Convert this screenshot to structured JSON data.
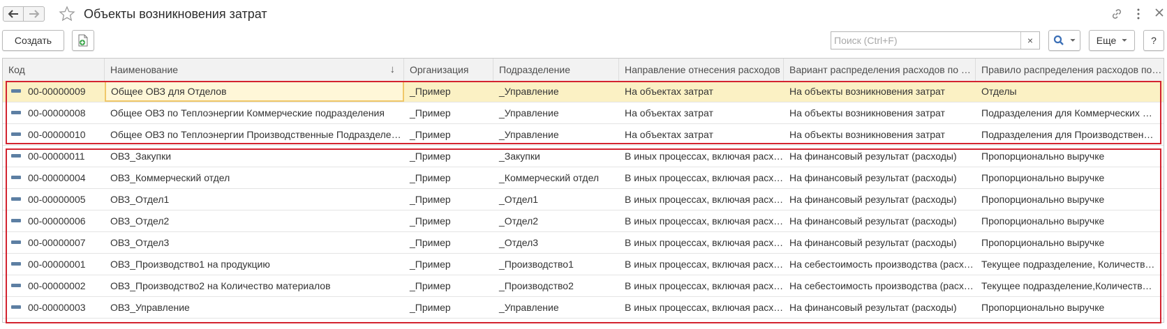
{
  "window": {
    "title": "Объекты возникновения затрат",
    "back_icon": "arrow-left-icon",
    "forward_icon": "arrow-right-icon",
    "favorite_icon": "star-icon",
    "link_icon": "link-icon",
    "menu_icon": "kebab-menu-icon",
    "close_icon": "close-icon"
  },
  "toolbar": {
    "create_label": "Создать",
    "copy_icon": "document-add-icon",
    "search_placeholder": "Поиск (Ctrl+F)",
    "search_value": "",
    "clear_label": "×",
    "more_label": "Еще",
    "help_label": "?"
  },
  "table": {
    "columns": [
      "Код",
      "Наименование",
      "Организация",
      "Подразделение",
      "Направление отнесения расходов",
      "Вариант распределения расходов по направлениям",
      "Правило распределения расходов по подразделениям"
    ],
    "sort_indicator": "↓",
    "rows": [
      [
        "00-00000009",
        "Общее ОВЗ для Отделов",
        "_Пример",
        "_Управление",
        "На объектах затрат",
        "На объекты возникновения затрат",
        "Отделы"
      ],
      [
        "00-00000008",
        "Общее ОВЗ по Теплоэнергии Коммерческие подразделения",
        "_Пример",
        "_Управление",
        "На объектах затрат",
        "На объекты возникновения затрат",
        "Подразделения для Коммерческих расходов"
      ],
      [
        "00-00000010",
        "Общее ОВЗ по Теплоэнергии Производственные Подразделения",
        "_Пример",
        "_Управление",
        "На объектах затрат",
        "На объекты возникновения затрат",
        "Подразделения для Производственных расходов"
      ],
      [
        "00-00000011",
        "ОВЗ_Закупки",
        "_Пример",
        "_Закупки",
        "В иных процессах, включая расходы",
        "На финансовый результат (расходы)",
        "Пропорционально выручке"
      ],
      [
        "00-00000004",
        "ОВЗ_Коммерческий отдел",
        "_Пример",
        "_Коммерческий отдел",
        "В иных процессах, включая расходы",
        "На финансовый результат (расходы)",
        "Пропорционально выручке"
      ],
      [
        "00-00000005",
        "ОВЗ_Отдел1",
        "_Пример",
        "_Отдел1",
        "В иных процессах, включая расходы",
        "На финансовый результат (расходы)",
        "Пропорционально выручке"
      ],
      [
        "00-00000006",
        "ОВЗ_Отдел2",
        "_Пример",
        "_Отдел2",
        "В иных процессах, включая расходы",
        "На финансовый результат (расходы)",
        "Пропорционально выручке"
      ],
      [
        "00-00000007",
        "ОВЗ_Отдел3",
        "_Пример",
        "_Отдел3",
        "В иных процессах, включая расходы",
        "На финансовый результат (расходы)",
        "Пропорционально выручке"
      ],
      [
        "00-00000001",
        "ОВЗ_Производство1 на продукцию",
        "_Пример",
        "_Производство1",
        "В иных процессах, включая расходы",
        "На себестоимость производства (расходы)",
        "Текущее подразделение, Количество продукции"
      ],
      [
        "00-00000002",
        "ОВЗ_Производство2 на Количество материалов",
        "_Пример",
        "_Производство2",
        "В иных процессах, включая расходы",
        "На себестоимость производства (расходы)",
        "Текущее подразделение,Количество материалов"
      ],
      [
        "00-00000003",
        "ОВЗ_Управление",
        "_Пример",
        "_Управление",
        "В иных процессах, включая расходы",
        "На финансовый результат (расходы)",
        "Пропорционально выручке"
      ]
    ]
  },
  "colors": {
    "selected_row": "#fbf1c4",
    "highlight_box": "#d3232f",
    "accent": "#4a7dbc"
  }
}
